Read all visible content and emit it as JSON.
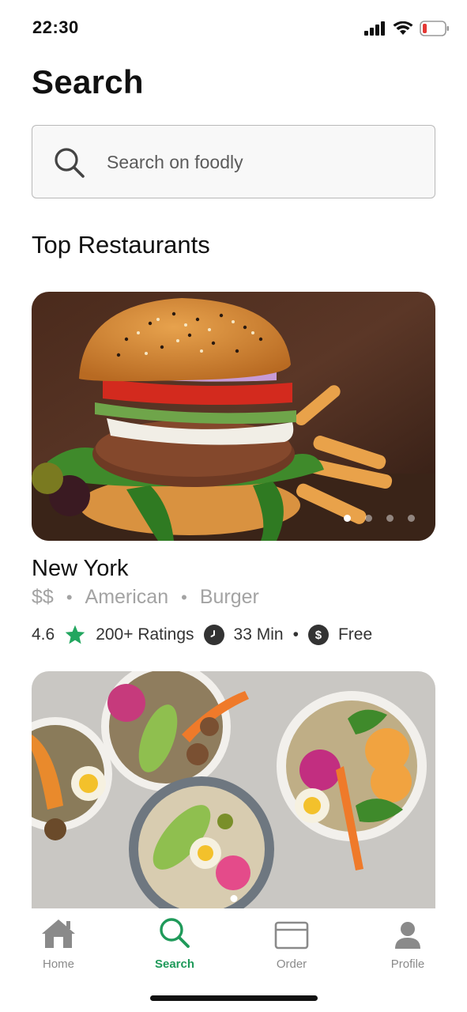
{
  "status_bar": {
    "time": "22:30"
  },
  "page": {
    "title": "Search"
  },
  "search": {
    "placeholder": "Search on foodly"
  },
  "section": {
    "title": "Top Restaurants"
  },
  "restaurants": [
    {
      "name": "New York",
      "price": "$$",
      "cuisine": "American",
      "category": "Burger",
      "rating": "4.6",
      "ratings_count": "200+ Ratings",
      "time": "33 Min",
      "delivery": "Free",
      "image_icon": "burger-photo",
      "carousel_count": 4,
      "carousel_active": 1
    },
    {
      "image_icon": "salad-bowls-photo",
      "carousel_count": 1,
      "carousel_active": 1
    }
  ],
  "tabbar": {
    "tabs": [
      {
        "label": "Home",
        "icon": "home-icon"
      },
      {
        "label": "Search",
        "icon": "search-icon"
      },
      {
        "label": "Order",
        "icon": "order-icon"
      },
      {
        "label": "Profile",
        "icon": "profile-icon"
      }
    ],
    "active": "Search"
  },
  "colors": {
    "accent": "#1f9a5a",
    "star": "#22a65f",
    "muted": "#a3a3a3"
  }
}
